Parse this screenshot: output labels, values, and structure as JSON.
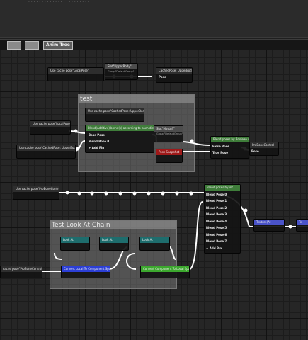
{
  "window": {
    "header_blur": "· · · · · · · · · · · · · · · · · · · · · · ·"
  },
  "tabs": {
    "active_label": "Anim Tree"
  },
  "comments": {
    "top": "test",
    "chain": "Test Look At Chain"
  },
  "nodes": {
    "cache_local_1": "Use cache pose\"LocalPose\"",
    "slot_upper": "Slot\"UpperBody\"",
    "slot_upper_group": "Group\"DefaultGroup\"",
    "cached_upper": "CachedPose: UpperBody",
    "cached_upper_pin": "Pose",
    "cache_upper_inner": "Use cache pose\"CachedPose: UpperBody\"",
    "cache_local_2": "Use cache pose\"LocalPose\"",
    "cache_upper_2": "Use cache pose\"CachedPose: UpperBody\"",
    "blend_title": "Blend(Additive) blend(s) according to each distance",
    "blend_base": "Base Pose",
    "blend_pose0": "Blend Pose 0",
    "blend_add": "+ Add Pin",
    "slot_mystuff": "Slot\"Mystuff\"",
    "slot_mystuff_group": "Group\"DefaultGroup\"",
    "pose_snapshot": "Pose Snapshot",
    "blend_bool": "Blend poses by Boolean value",
    "false_pose": "False Pose",
    "true_pose": "True Pose",
    "probone": "ProBoneControl",
    "probone_pin": "Pose",
    "cache_probone": "Use cache pose\"ProBoneControl\"",
    "blend_int": "Blend poses by int",
    "int_pins": [
      "Blend Pose 0",
      "Blend Pose 1",
      "Blend Pose 2",
      "Blend Pose 3",
      "Blend Pose 4",
      "Blend Pose 5",
      "Blend Pose 6",
      "Blend Pose 7"
    ],
    "int_add": "+ Add Pin",
    "textured": "Texture(A)",
    "far_right": "Te",
    "lookat_1": "Look At",
    "lookat_2": "Look At",
    "lookat_3": "Look At",
    "cache_probone_2": "cache pose\"ProBoneControl\"",
    "local_to_comp": "Convert Local To Component Space",
    "comp_to_local": "Convert Component To Local Space"
  }
}
